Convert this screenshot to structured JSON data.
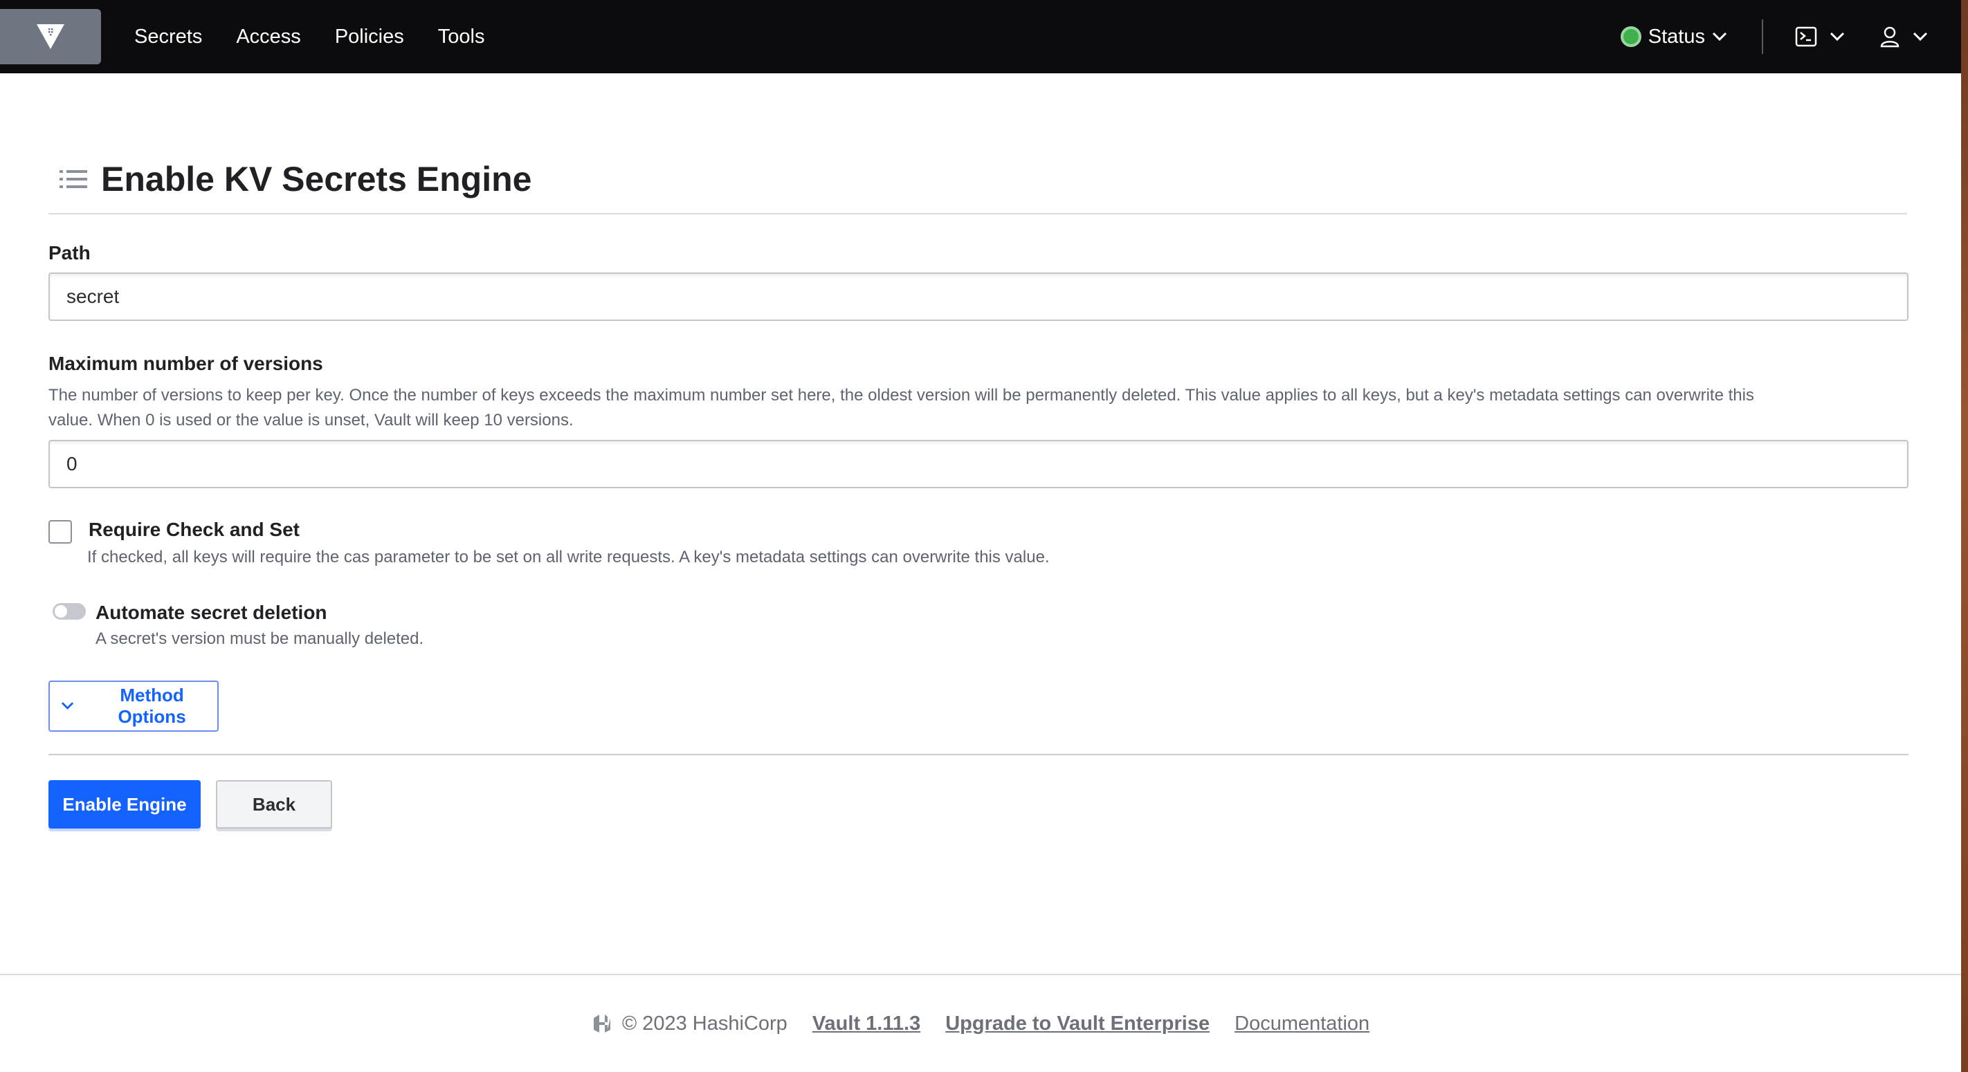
{
  "nav": {
    "links": [
      "Secrets",
      "Access",
      "Policies",
      "Tools"
    ],
    "status_label": "Status"
  },
  "page": {
    "title": "Enable KV Secrets Engine"
  },
  "form": {
    "path": {
      "label": "Path",
      "value": "secret"
    },
    "max_versions": {
      "label": "Maximum number of versions",
      "help_line1": "The number of versions to keep per key. Once the number of keys exceeds the maximum number set here, the oldest version will be permanently deleted. This value applies to all keys, but a key's metadata settings can overwrite this",
      "help_line2": "value. When 0 is used or the value is unset, Vault will keep 10 versions.",
      "value": "0"
    },
    "cas": {
      "label": "Require Check and Set",
      "help": "If checked, all keys will require the cas parameter to be set on all write requests. A key's metadata settings can overwrite this value.",
      "checked": false
    },
    "auto_delete": {
      "label": "Automate secret deletion",
      "help": "A secret's version must be manually deleted.",
      "enabled": false
    },
    "method_options_label": "Method Options",
    "submit_label": "Enable Engine",
    "back_label": "Back"
  },
  "footer": {
    "copyright": "© 2023 HashiCorp",
    "version_link": "Vault 1.11.3",
    "upgrade_link": "Upgrade to Vault Enterprise",
    "docs_link": "Documentation"
  },
  "colors": {
    "nav_bg": "#0c0c0e",
    "primary": "#1563ff",
    "status_ok": "#3fb04c"
  }
}
